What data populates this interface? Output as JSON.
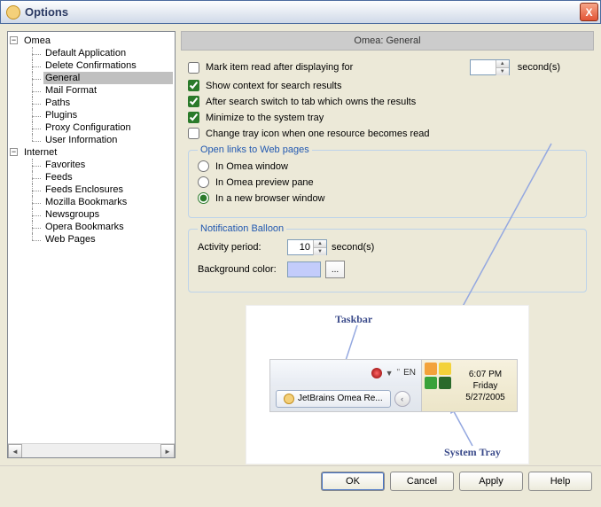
{
  "window": {
    "title": "Options",
    "close": "X"
  },
  "tree": {
    "roots": [
      {
        "label": "Omea",
        "expanded": true,
        "children": [
          {
            "label": "Default Application"
          },
          {
            "label": "Delete Confirmations"
          },
          {
            "label": "General",
            "selected": true
          },
          {
            "label": "Mail Format"
          },
          {
            "label": "Paths"
          },
          {
            "label": "Plugins"
          },
          {
            "label": "Proxy Configuration"
          },
          {
            "label": "User Information"
          }
        ]
      },
      {
        "label": "Internet",
        "expanded": true,
        "children": [
          {
            "label": "Favorites"
          },
          {
            "label": "Feeds"
          },
          {
            "label": "Feeds Enclosures"
          },
          {
            "label": "Mozilla Bookmarks"
          },
          {
            "label": "Newsgroups"
          },
          {
            "label": "Opera Bookmarks"
          },
          {
            "label": "Web Pages"
          }
        ]
      }
    ]
  },
  "panel": {
    "header": "Omea: General",
    "opts": {
      "mark_read": {
        "label": "Mark item read after displaying for",
        "checked": false,
        "value": "",
        "unit": "second(s)"
      },
      "show_context": {
        "label": "Show context for search results",
        "checked": true
      },
      "switch_tab": {
        "label": "After search switch to tab which owns the results",
        "checked": true
      },
      "min_tray": {
        "label": "Minimize to the system tray",
        "checked": true
      },
      "change_icon": {
        "label": "Change tray icon when one resource becomes read",
        "checked": false
      }
    },
    "open_links": {
      "legend": "Open links to Web pages",
      "opts": [
        {
          "label": "In Omea window",
          "checked": false
        },
        {
          "label": "In Omea preview pane",
          "checked": false
        },
        {
          "label": "In a new browser window",
          "checked": true
        }
      ]
    },
    "balloon": {
      "legend": "Notification Balloon",
      "activity_label": "Activity period:",
      "activity_value": "10",
      "activity_unit": "second(s)",
      "bgcolor_label": "Background color:",
      "bgcolor": "#c3ccfb",
      "ellipsis": "..."
    }
  },
  "illustration": {
    "taskbar_label": "Taskbar",
    "systray_label": "System Tray",
    "lang": "EN",
    "app_btn": "JetBrains Omea Re...",
    "time": "6:07 PM",
    "day": "Friday",
    "date": "5/27/2005"
  },
  "buttons": {
    "ok": "OK",
    "cancel": "Cancel",
    "apply": "Apply",
    "help": "Help"
  }
}
